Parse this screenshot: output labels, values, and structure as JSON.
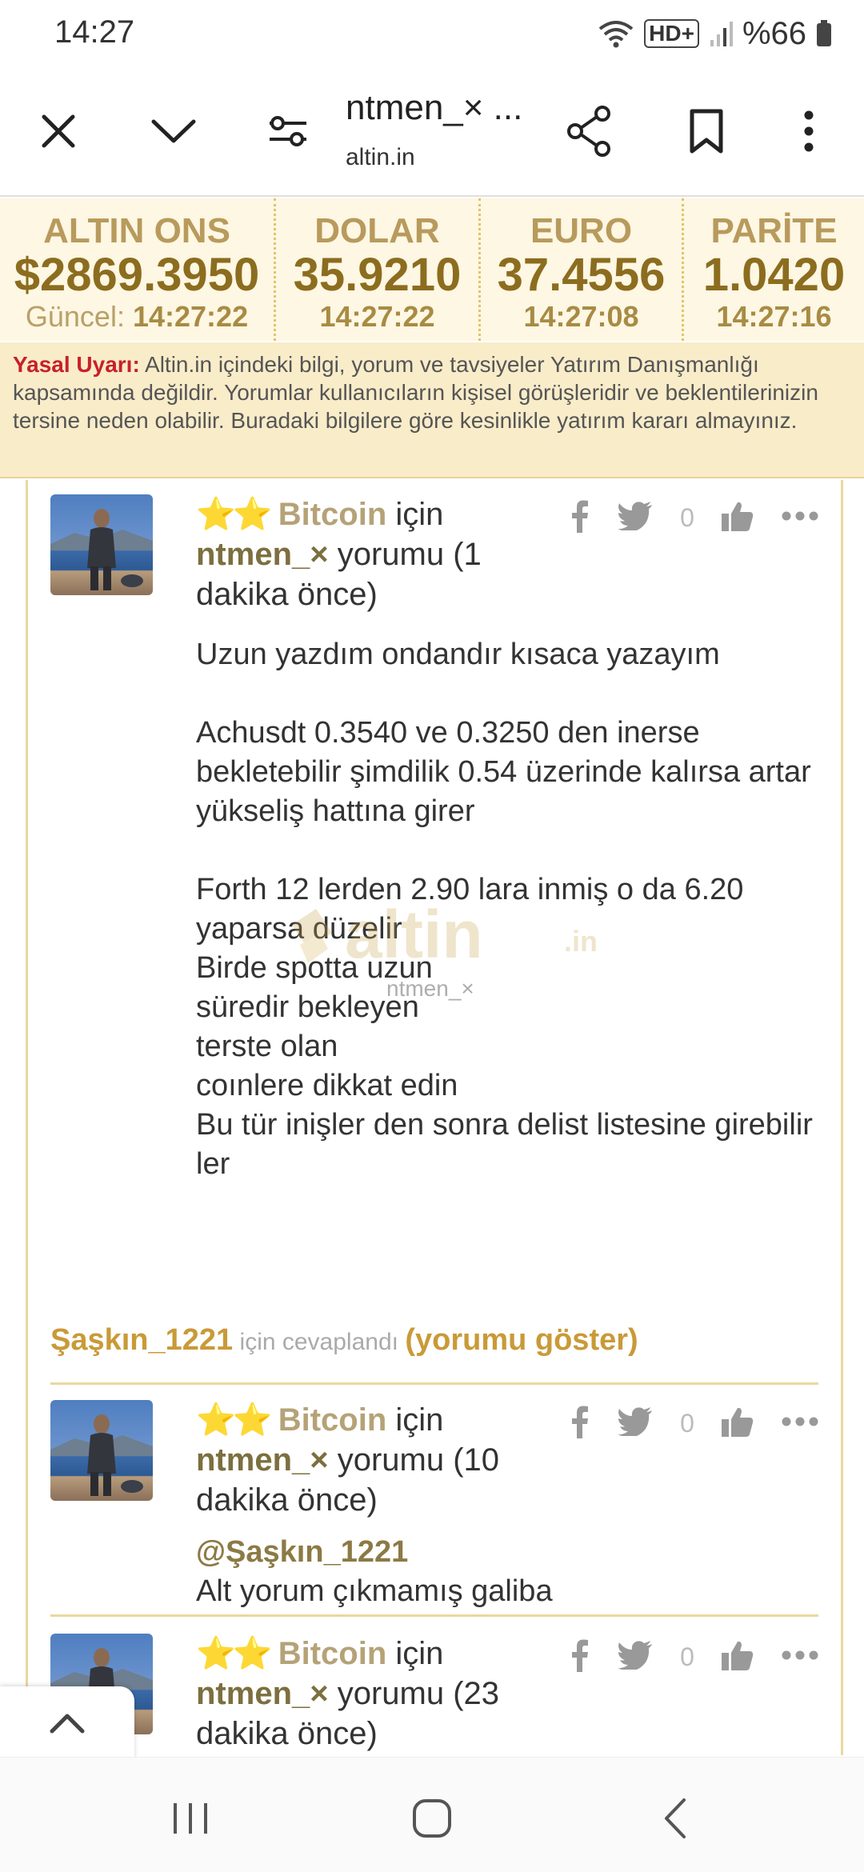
{
  "status": {
    "time": "14:27",
    "network": "HD+",
    "battery": "%66"
  },
  "browser": {
    "title": "ntmen_× ...",
    "domain": "altin.in"
  },
  "ticker": [
    {
      "label": "ALTIN ONS",
      "value": "$2869.3950",
      "time_prefix": "Güncel:",
      "time": "14:27:22"
    },
    {
      "label": "DOLAR",
      "value": "35.9210",
      "time_prefix": "",
      "time": "14:27:22"
    },
    {
      "label": "EURO",
      "value": "37.4556",
      "time_prefix": "",
      "time": "14:27:08"
    },
    {
      "label": "PARİTE",
      "value": "1.0420",
      "time_prefix": "",
      "time": "14:27:16"
    }
  ],
  "warning": {
    "label": "Yasal Uyarı:",
    "text": " Altin.in içindeki bilgi, yorum ve tavsiyeler Yatırım Danışmanlığı kapsamında değildir. Yorumlar kullanıcıların kişisel görüşleridir ve beklentilerinizin tersine neden olabilir. Buradaki bilgilere göre kesinlikle yatırım kararı almayınız."
  },
  "watermark": {
    "brand": "altin",
    "suffix": ".in",
    "user": "ntmen_×"
  },
  "comments": [
    {
      "stars": "⭐⭐",
      "category": "Bitcoin",
      "for_word": " için",
      "user": "ntmen_×",
      "meta": " yorumu (1 dakika önce)",
      "likes": "0",
      "mention": "",
      "body": [
        "Uzun yazdım ondandır kısaca yazayım",
        "",
        "Achusdt 0.3540 ve 0.3250 den inerse bekletebilir şimdilik 0.54 üzerinde kalırsa artar",
        "yükseliş hattına girer",
        "",
        "Forth 12 lerden 2.90 lara inmiş o da 6.20 yaparsa düzelir",
        "Birde spotta uzun",
        "süredir bekleyen",
        "terste olan",
        "coınlere dikkat edin",
        "Bu tür inişler den sonra delist listesine girebilir ler"
      ]
    },
    {
      "stars": "⭐⭐",
      "category": "Bitcoin",
      "for_word": " için",
      "user": "ntmen_×",
      "meta": " yorumu (10 dakika önce)",
      "likes": "0",
      "mention": "@Şaşkın_1221",
      "body": [
        "Alt yorum çıkmamış galiba"
      ]
    },
    {
      "stars": "⭐⭐",
      "category": "Bitcoin",
      "for_word": " için",
      "user": "ntmen_×",
      "meta": " yorumu (23 dakika önce)",
      "likes": "0",
      "mention": "",
      "body": []
    }
  ],
  "reply": {
    "user": "Şaşkın_1221",
    "note": " için cevaplandı ",
    "show": "(yorumu göster)"
  }
}
